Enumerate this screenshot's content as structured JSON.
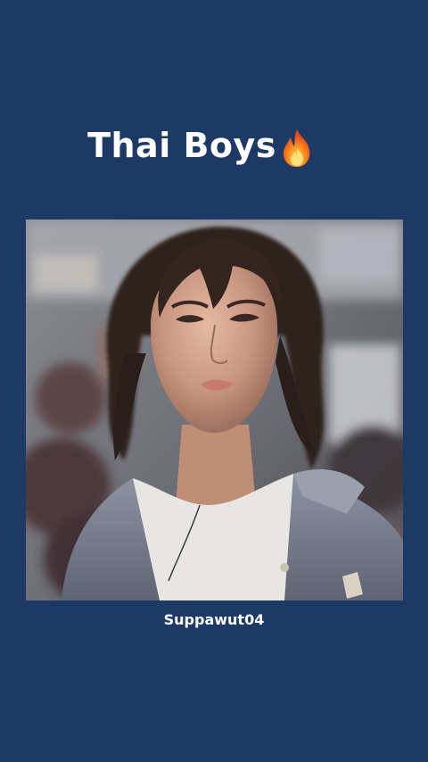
{
  "post": {
    "title": "Thai Boys",
    "title_emoji": "fire-icon",
    "caption": "Suppawut04",
    "background_color": "#1d3a66"
  }
}
